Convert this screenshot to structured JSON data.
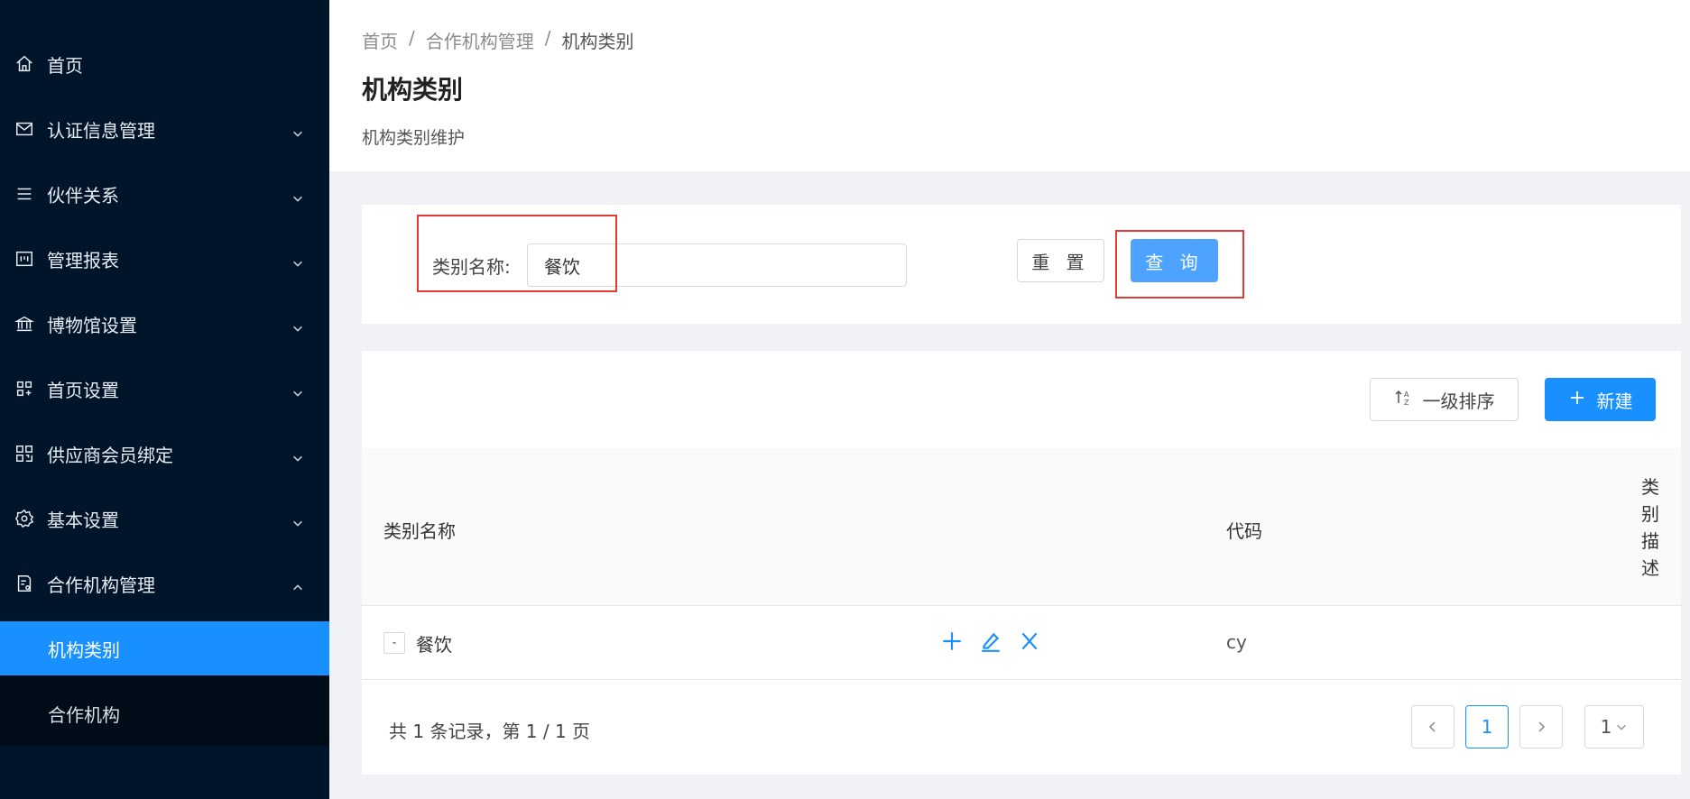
{
  "sidebar": {
    "items": [
      {
        "label": "首页",
        "icon": "home-icon",
        "has_children": false
      },
      {
        "label": "认证信息管理",
        "icon": "mail-icon",
        "has_children": true
      },
      {
        "label": "伙伴关系",
        "icon": "list-icon",
        "has_children": true
      },
      {
        "label": "管理报表",
        "icon": "report-icon",
        "has_children": true
      },
      {
        "label": "博物馆设置",
        "icon": "bank-icon",
        "has_children": true
      },
      {
        "label": "首页设置",
        "icon": "grid-icon",
        "has_children": true
      },
      {
        "label": "供应商会员绑定",
        "icon": "qrcode-icon",
        "has_children": true
      },
      {
        "label": "基本设置",
        "icon": "gear-icon",
        "has_children": true
      },
      {
        "label": "合作机构管理",
        "icon": "file-icon",
        "has_children": true,
        "expanded": true
      }
    ],
    "subitems": [
      {
        "label": "机构类别",
        "active": true
      },
      {
        "label": "合作机构",
        "active": false
      }
    ]
  },
  "breadcrumb": [
    "首页",
    "合作机构管理",
    "机构类别"
  ],
  "breadcrumb_sep": "/",
  "page": {
    "title": "机构类别",
    "description": "机构类别维护"
  },
  "search": {
    "label": "类别名称:",
    "value": "餐饮",
    "reset_label": "重 置",
    "query_label": "查 询"
  },
  "toolbar": {
    "sort_label": "一级排序",
    "new_label": "新建"
  },
  "table": {
    "columns": [
      "类别名称",
      "代码",
      "类别描述"
    ],
    "rows": [
      {
        "expand": "-",
        "name": "餐饮",
        "code": "cy",
        "description": ""
      }
    ]
  },
  "pagination": {
    "summary": "共 1 条记录，第 1 / 1 页",
    "current": "1",
    "page_size": "1"
  },
  "colors": {
    "sidebar_bg": "#001529",
    "submenu_bg": "#000c17",
    "primary": "#1890ff",
    "query_button": "#4da3ff",
    "highlight": "#e53935"
  }
}
